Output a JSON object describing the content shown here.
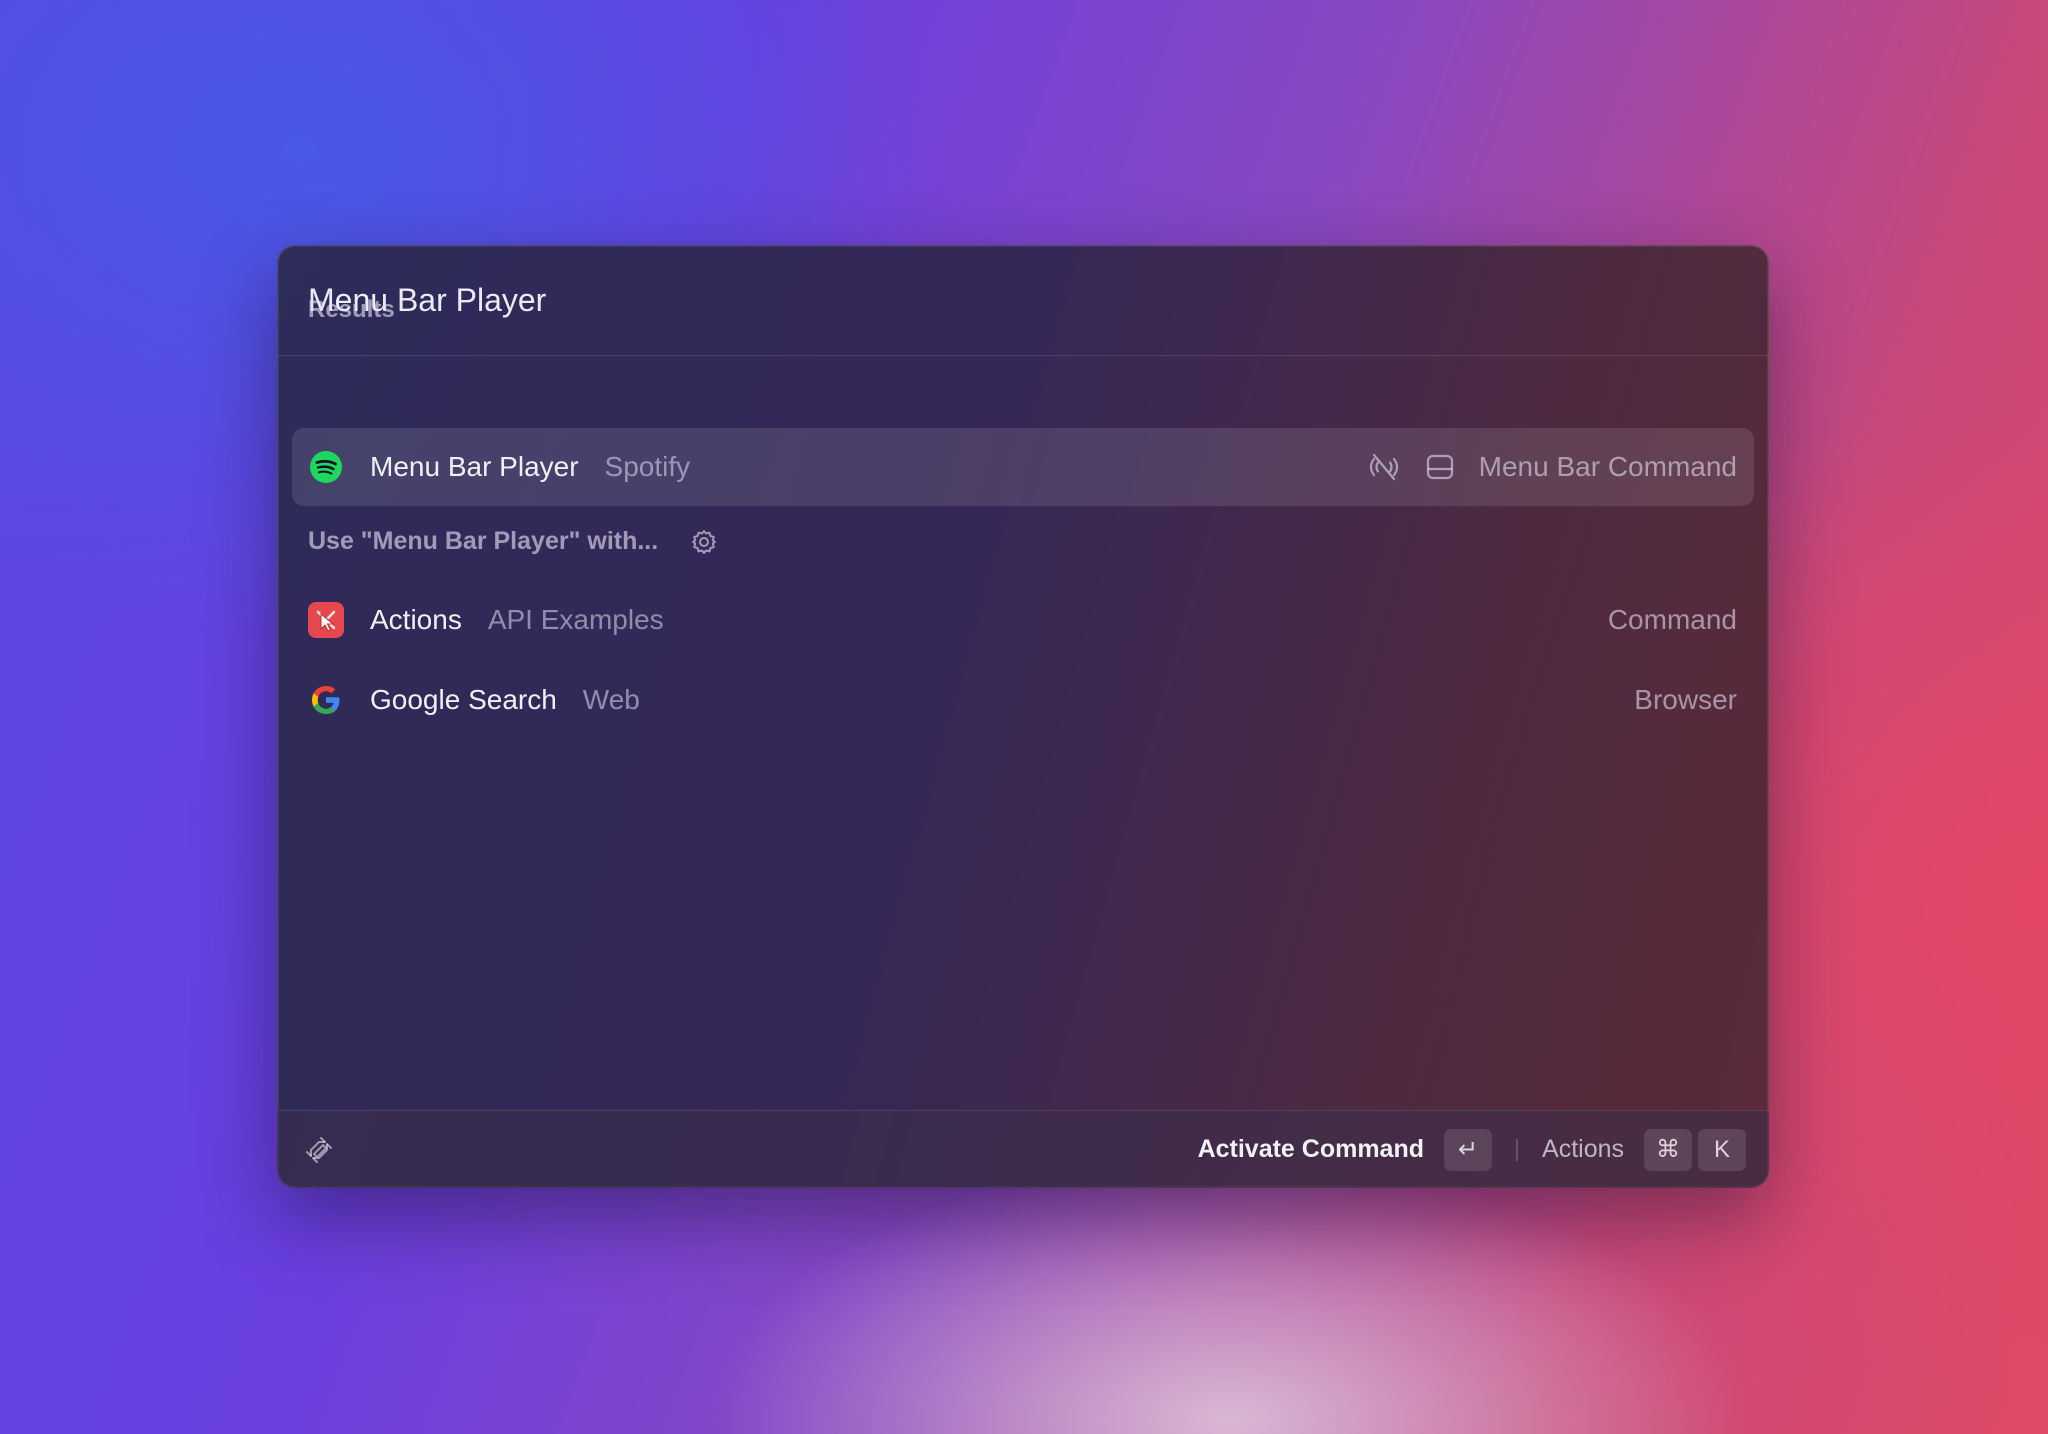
{
  "search": {
    "query": "Menu Bar Player"
  },
  "results_section": {
    "title": "Results",
    "items": [
      {
        "title": "Menu Bar Player",
        "subtitle": "Spotify",
        "icon": "spotify-icon",
        "accessory_icons": [
          "no-signal-icon",
          "menu-bar-icon"
        ],
        "accessory": "Menu Bar Command",
        "selected": true
      }
    ]
  },
  "use_with_section": {
    "title": "Use \"Menu Bar Player\" with...",
    "icon": "gear-icon",
    "items": [
      {
        "title": "Actions",
        "subtitle": "API Examples",
        "icon": "actions-icon",
        "accessory": "Command"
      },
      {
        "title": "Google Search",
        "subtitle": "Web",
        "icon": "google-icon",
        "accessory": "Browser"
      }
    ]
  },
  "footer": {
    "logo_icon": "raycast-logo-icon",
    "primary_action": "Activate Command",
    "primary_key": "↵",
    "secondary_action": "Actions",
    "secondary_keys": [
      "⌘",
      "K"
    ]
  },
  "colors": {
    "spotify_green": "#1ed760",
    "actions_red": "#e5484d"
  }
}
